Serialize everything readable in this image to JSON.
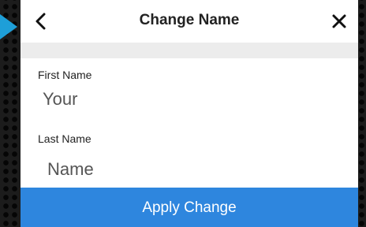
{
  "header": {
    "title": "Change Name",
    "back_icon": "chevron-left-icon",
    "close_icon": "close-icon"
  },
  "form": {
    "first_name": {
      "label": "First Name",
      "placeholder": "Your",
      "value": ""
    },
    "last_name": {
      "label": "Last Name",
      "placeholder": "Name",
      "value": ""
    }
  },
  "apply_button": {
    "label": "Apply Change"
  },
  "colors": {
    "accent": "#2e86de",
    "pointer": "#1e9fd8",
    "band": "#ececec"
  }
}
